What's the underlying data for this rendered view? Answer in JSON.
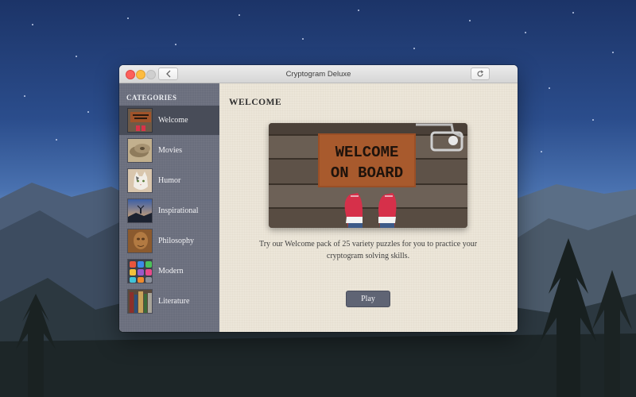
{
  "window": {
    "title": "Cryptogram Deluxe",
    "buttons": {
      "back": "chevron-left-icon",
      "refresh": "refresh-icon",
      "sidebar": "sidebar-icon"
    }
  },
  "sidebar": {
    "header": "CATEGORIES",
    "items": [
      {
        "label": "Welcome",
        "thumb": "welcome-mat-thumbnail",
        "selected": true
      },
      {
        "label": "Movies",
        "thumb": "film-reels-thumbnail",
        "selected": false
      },
      {
        "label": "Humor",
        "thumb": "cat-thumbnail",
        "selected": false
      },
      {
        "label": "Inspirational",
        "thumb": "sunset-silhouette-thumbnail",
        "selected": false
      },
      {
        "label": "Philosophy",
        "thumb": "stone-statue-thumbnail",
        "selected": false
      },
      {
        "label": "Modern",
        "thumb": "app-icons-thumbnail",
        "selected": false
      },
      {
        "label": "Literature",
        "thumb": "books-thumbnail",
        "selected": false
      }
    ]
  },
  "main": {
    "title": "WELCOME",
    "hero": {
      "mat_line1": "WELCOME",
      "mat_line2": "ON BOARD"
    },
    "description": "Try our Welcome pack of 25 variety puzzles for you to practice your cryptogram solving skills.",
    "play_label": "Play"
  },
  "colors": {
    "sidebar_bg": "#6a6e7d",
    "sidebar_selected": "#484c58",
    "content_bg": "#ece6d9",
    "play_button": "#5f6474"
  }
}
